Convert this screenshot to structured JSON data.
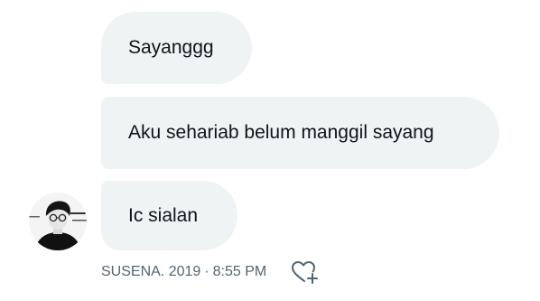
{
  "messages": [
    {
      "text": "Sayanggg"
    },
    {
      "text": "Aku sehariab belum manggil sayang"
    },
    {
      "text": "Ic sialan"
    }
  ],
  "meta": {
    "sender": "SUSENA. 2019",
    "separator": "·",
    "time": "8:55 PM"
  },
  "icons": {
    "reaction": "heart-plus-icon",
    "avatar": "avatar"
  },
  "colors": {
    "bubble_bg": "#eff3f4",
    "text": "#0f1419",
    "meta_text": "#536471"
  }
}
